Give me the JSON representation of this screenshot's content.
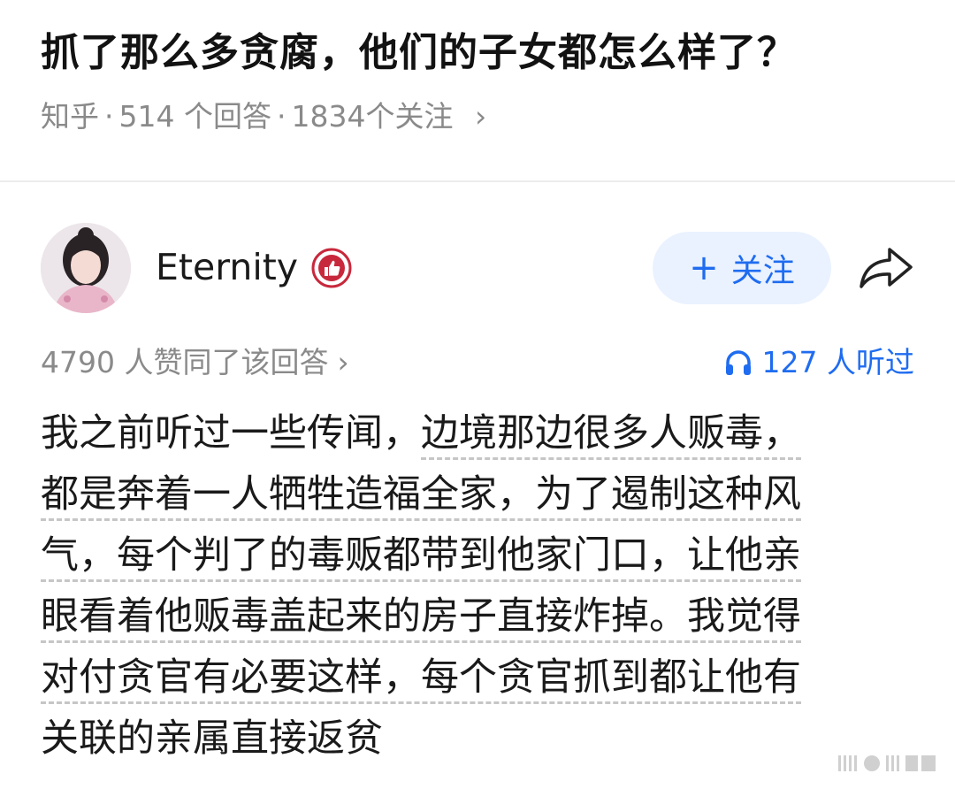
{
  "question": {
    "title": "抓了那么多贪腐，他们的子女都怎么样了？",
    "source": "知乎",
    "answers_count": "514 个回答",
    "followers_count": "1834个关注",
    "chevron": "›"
  },
  "author": {
    "name": "Eternity",
    "avatar_icon": "avatar-portrait",
    "badge_icon": "thumbs-up-badge-icon",
    "follow_label": "关注",
    "follow_plus": "+",
    "share_icon": "share-arrow-icon"
  },
  "stats": {
    "likes_text": "4790 人赞同了该回答",
    "likes_chevron": "›",
    "listened_text": "127 人听过",
    "listened_icon": "headphones-icon"
  },
  "answer": {
    "lines": [
      {
        "plain": "我之前听过一些传闻，",
        "underlined": "边境那边很多人贩毒，"
      },
      {
        "plain": "",
        "underlined": "都是奔着一人牺牲造福全家，为了遏制这种风"
      },
      {
        "plain": "",
        "underlined": "气，每个判了的毒贩都带到他家门口，让他亲"
      },
      {
        "plain": "",
        "underlined": "眼看着他贩毒盖起来的房子直接炸掉。我觉得"
      },
      {
        "plain": "",
        "underlined": "对付贪官有必要这样，每个贪官抓到都让他有"
      },
      {
        "plain": "关联的亲属直接返贫",
        "underlined": ""
      }
    ]
  },
  "colors": {
    "accent": "#1f6cf0",
    "follow_bg": "#eaf2ff",
    "meta_gray": "#8a8a8a",
    "badge_red": "#c8283c"
  }
}
